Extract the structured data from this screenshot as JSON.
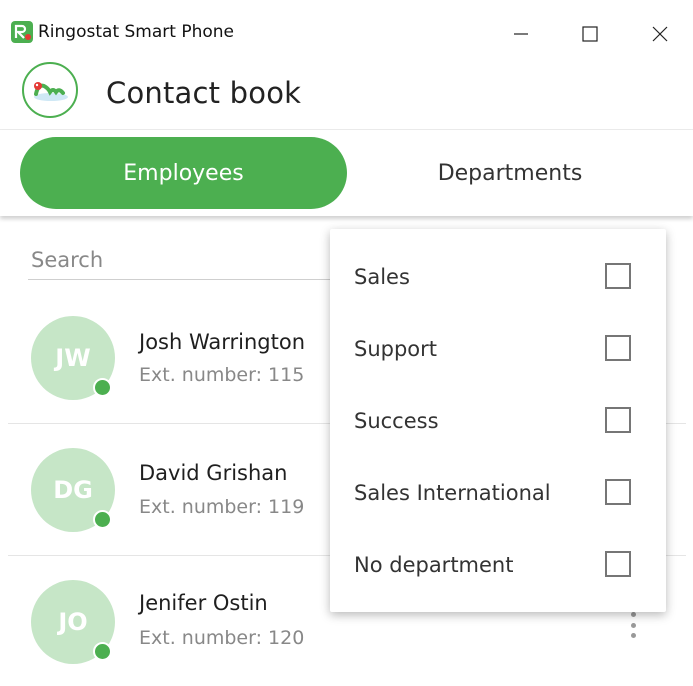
{
  "window": {
    "title": "Ringostat Smart Phone",
    "app_icon": "ringostat-logo-icon",
    "controls": [
      "minimize-icon",
      "maximize-icon",
      "close-icon"
    ]
  },
  "header": {
    "title": "Contact book",
    "logo": "ringostat-mascot-logo"
  },
  "tabs": [
    {
      "label": "Employees",
      "active": true
    },
    {
      "label": "Departments",
      "active": false
    }
  ],
  "search": {
    "placeholder": "Search",
    "value": ""
  },
  "contacts": [
    {
      "initials": "JW",
      "name": "Josh Warrington",
      "ext": "Ext. number: 115",
      "status": "online"
    },
    {
      "initials": "DG",
      "name": "David Grishan",
      "ext": "Ext. number: 119",
      "status": "online"
    },
    {
      "initials": "JO",
      "name": "Jenifer Ostin",
      "ext": "Ext. number: 120",
      "status": "online"
    }
  ],
  "department_filter": {
    "items": [
      {
        "label": "Sales",
        "checked": false
      },
      {
        "label": "Support",
        "checked": false
      },
      {
        "label": "Success",
        "checked": false
      },
      {
        "label": "Sales International",
        "checked": false
      },
      {
        "label": "No department",
        "checked": false
      }
    ]
  },
  "colors": {
    "accent": "#4caf50",
    "avatar_bg": "#c6e6c7",
    "text_secondary": "#888888"
  }
}
